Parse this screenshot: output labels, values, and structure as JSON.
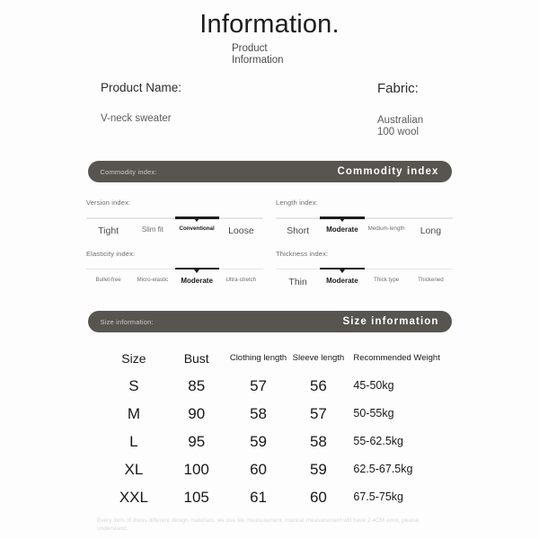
{
  "header": {
    "title": "Information.",
    "subtitle": "Product Information"
  },
  "product": {
    "name_label": "Product Name:",
    "name_value": "V-neck sweater",
    "fabric_label": "Fabric:",
    "fabric_value": "Australian 100 wool"
  },
  "banners": {
    "commodity": {
      "left": "Commodity index:",
      "right": "Commodity index"
    },
    "size": {
      "left": "Size information:",
      "right": "Size information"
    }
  },
  "indexes": [
    {
      "title": "Version index:",
      "options": [
        "Tight",
        "Slim fit",
        "Conventional",
        "Loose"
      ],
      "sizes": [
        "size-lg",
        "size-md",
        "size-sm",
        "size-lg"
      ],
      "selected": 2
    },
    {
      "title": "Length index:",
      "options": [
        "Short",
        "Moderate",
        "Medium-length",
        "Long"
      ],
      "sizes": [
        "size-lg",
        "size-md",
        "size-sm",
        "size-lg"
      ],
      "selected": 1
    },
    {
      "title": "Elasticity index:",
      "options": [
        "Bullet-free",
        "Micro-elastic",
        "Moderate",
        "Ultra-stretch"
      ],
      "sizes": [
        "size-sm",
        "size-sm",
        "size-md",
        "size-sm"
      ],
      "selected": 2
    },
    {
      "title": "Thickness index:",
      "options": [
        "Thin",
        "Moderate",
        "Thick type",
        "Thickened"
      ],
      "sizes": [
        "size-lg",
        "size-md",
        "size-sm",
        "size-sm"
      ],
      "selected": 1
    }
  ],
  "size_table": {
    "columns": [
      "Size",
      "Bust",
      "Clothing length",
      "Sleeve length",
      "Recommended Weight"
    ],
    "rows": [
      [
        "S",
        "85",
        "57",
        "56",
        "45-50kg"
      ],
      [
        "M",
        "90",
        "58",
        "57",
        "50-55kg"
      ],
      [
        "L",
        "95",
        "59",
        "58",
        "55-62.5kg"
      ],
      [
        "XL",
        "100",
        "60",
        "59",
        "62.5-67.5kg"
      ],
      [
        "XXL",
        "105",
        "61",
        "60",
        "67.5-75kg"
      ]
    ]
  },
  "footer": {
    "disclaimer": "Every item of dress different design materials, we use tile measurement, manual measurement will have 2-4CM error, please understand."
  },
  "colors": {
    "banner_bg": "#585550",
    "banner_right_text": "#ffffff",
    "banner_left_text": "#cfcac3",
    "track": "#e6e6e6",
    "track_active": "#1d1d1d",
    "page_bg": "#fdfdfd",
    "footer_text": "#d9d9d9"
  }
}
